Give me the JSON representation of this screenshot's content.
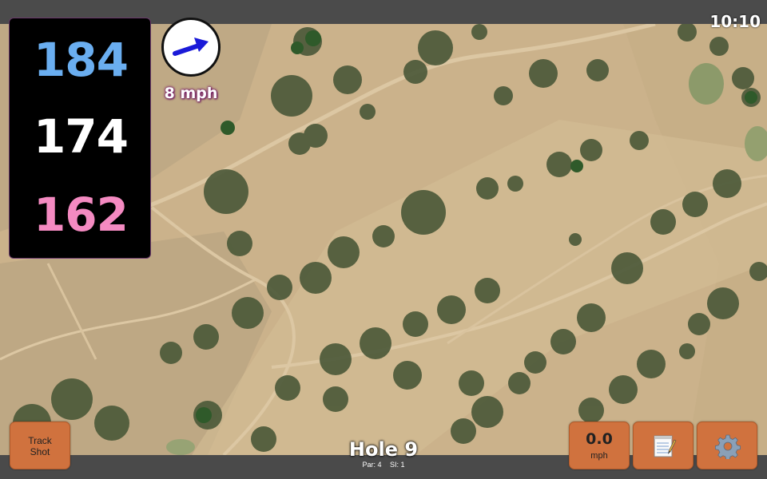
{
  "status": {
    "time": "10:10"
  },
  "yardages": {
    "back": "184",
    "middle": "174",
    "front": "162"
  },
  "wind": {
    "speed": "8 mph",
    "direction_icon": "wind-arrow-icon"
  },
  "hole": {
    "title": "Hole 9",
    "par": "Par: 4",
    "stroke_index": "SI: 1"
  },
  "buttons": {
    "track_shot_line1": "Track",
    "track_shot_line2": "Shot",
    "speed_value": "0.0",
    "speed_unit": "mph",
    "notes_icon": "notepad-icon",
    "settings_icon": "gear-icon"
  },
  "colors": {
    "back_yardage": "#6aaef0",
    "middle_yardage": "#ffffff",
    "front_yardage": "#f48ac1",
    "button_bg": "#d0723e",
    "wind_arrow": "#1a1ad8"
  }
}
